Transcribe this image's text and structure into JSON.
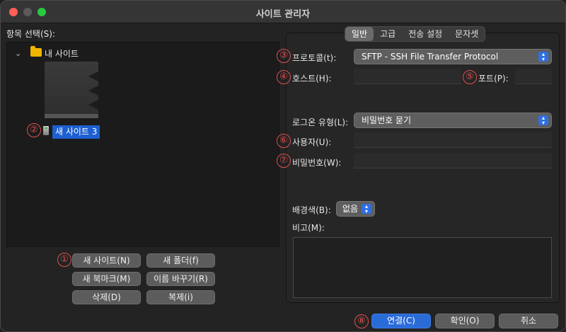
{
  "window": {
    "title": "사이트 관리자"
  },
  "left": {
    "tree_label": "항목 선택(S):",
    "root_folder": "내 사이트",
    "selected_site": "새 사이트 3"
  },
  "buttons": {
    "new_site": "새 사이트(N)",
    "new_folder": "새 폴더(f)",
    "new_bookmark": "새 북마크(M)",
    "rename": "이름 바꾸기(R)",
    "delete": "삭제(D)",
    "duplicate": "복제(i)"
  },
  "tabs": [
    "일반",
    "고급",
    "전송 설정",
    "문자셋"
  ],
  "active_tab": "일반",
  "general": {
    "protocol_label": "프로토콜(t):",
    "protocol_value": "SFTP - SSH File Transfer Protocol",
    "host_label": "호스트(H):",
    "host_value": "",
    "port_label": "포트(P):",
    "port_value": "",
    "logon_label": "로그온 유형(L):",
    "logon_value": "비밀번호 묻기",
    "user_label": "사용자(U):",
    "user_value": "",
    "password_label": "비밀번호(W):",
    "password_value": "",
    "bgcolor_label": "배경색(B):",
    "bgcolor_value": "없음",
    "memo_label": "비고(M):",
    "memo_value": ""
  },
  "footer": {
    "connect": "연결(C)",
    "ok": "확인(O)",
    "cancel": "취소"
  },
  "markers": [
    "①",
    "②",
    "③",
    "④",
    "⑤",
    "⑥",
    "⑦",
    "⑧"
  ],
  "colors": {
    "accent": "#2a6bd8",
    "marker": "#e05050",
    "folder": "#f2b500"
  }
}
